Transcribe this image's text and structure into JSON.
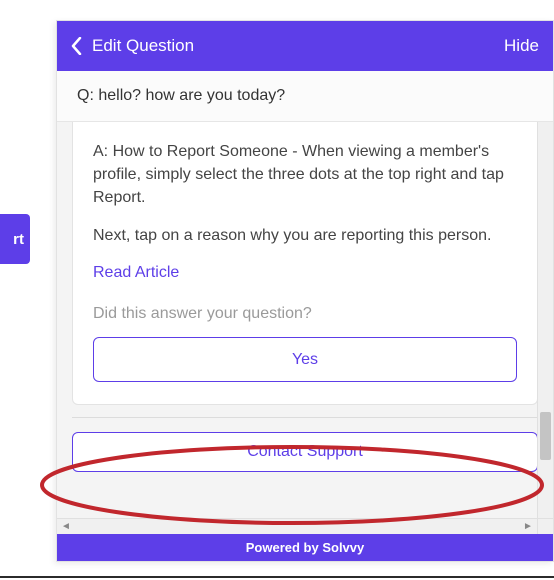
{
  "partial_button_text": "rt",
  "header": {
    "title": "Edit Question",
    "hide_label": "Hide"
  },
  "question": {
    "prefix": "Q:",
    "text": "hello? how are you today?"
  },
  "answer": {
    "para1": "A: How to Report Someone - When viewing a member's profile, simply select the three dots at the top right and tap Report.",
    "para2": "Next, tap on a reason why you are reporting this person.",
    "read_article": "Read Article",
    "did_answer": "Did this answer your question?",
    "yes_label": "Yes"
  },
  "contact_support_label": "Contact Support",
  "footer_text": "Powered by Solvvy",
  "colors": {
    "brand": "#5d3ee8",
    "highlight": "#c1272d"
  }
}
